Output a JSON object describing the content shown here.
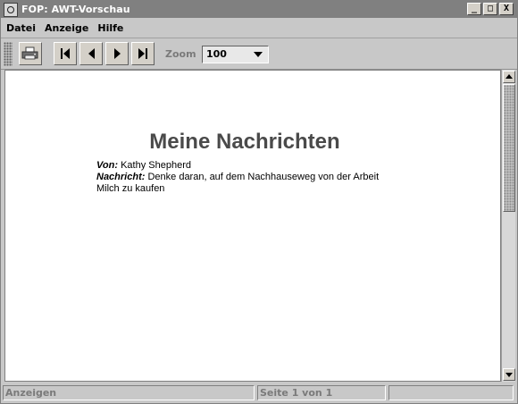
{
  "window": {
    "title": "FOP: AWT-Vorschau",
    "controls": [
      "_",
      "□",
      "X"
    ]
  },
  "menu": {
    "items": [
      "Datei",
      "Anzeige",
      "Hilfe"
    ]
  },
  "toolbar": {
    "print_icon": "printer-icon",
    "first_icon": "first-page-icon",
    "prev_icon": "previous-page-icon",
    "next_icon": "next-page-icon",
    "last_icon": "last-page-icon",
    "zoom_label": "Zoom",
    "zoom_value": "100"
  },
  "document": {
    "title": "Meine Nachrichten",
    "from_label": "Von:",
    "from_value": "Kathy Shepherd",
    "message_label": "Nachricht:",
    "message_text": "Denke daran, auf dem Nachhauseweg von der Arbeit Milch zu kaufen"
  },
  "status": {
    "left": "Anzeigen",
    "middle": "Seite 1 von 1",
    "right": ""
  }
}
